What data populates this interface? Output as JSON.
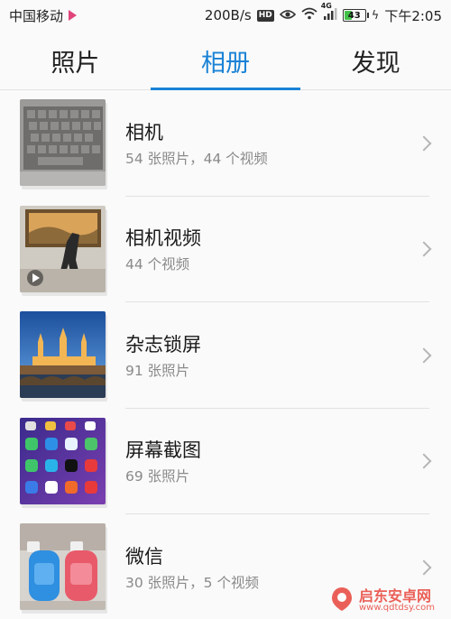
{
  "status_bar": {
    "carrier": "中国移动",
    "speed": "200B/s",
    "hd": "HD",
    "network": "4G",
    "battery": "43",
    "time": "下午2:05"
  },
  "tabs": [
    {
      "label": "照片",
      "active": false
    },
    {
      "label": "相册",
      "active": true
    },
    {
      "label": "发现",
      "active": false
    }
  ],
  "albums": [
    {
      "name": "相机",
      "count": "54 张照片，44 个视频",
      "thumbnail": "keyboard-photo"
    },
    {
      "name": "相机视频",
      "count": "44 个视频",
      "thumbnail": "video-frame"
    },
    {
      "name": "杂志锁屏",
      "count": "91 张照片",
      "thumbnail": "cathedral-night"
    },
    {
      "name": "屏幕截图",
      "count": "69 张照片",
      "thumbnail": "homescreen"
    },
    {
      "name": "微信",
      "count": "30 张照片，5 个视频",
      "thumbnail": "water-bottles"
    }
  ],
  "watermark": {
    "main": "启东安卓网",
    "sub": "www.qdtdsy.com"
  },
  "colors": {
    "accent": "#1a82d6",
    "battery": "#44c04a",
    "watermark": "#e8463c"
  }
}
